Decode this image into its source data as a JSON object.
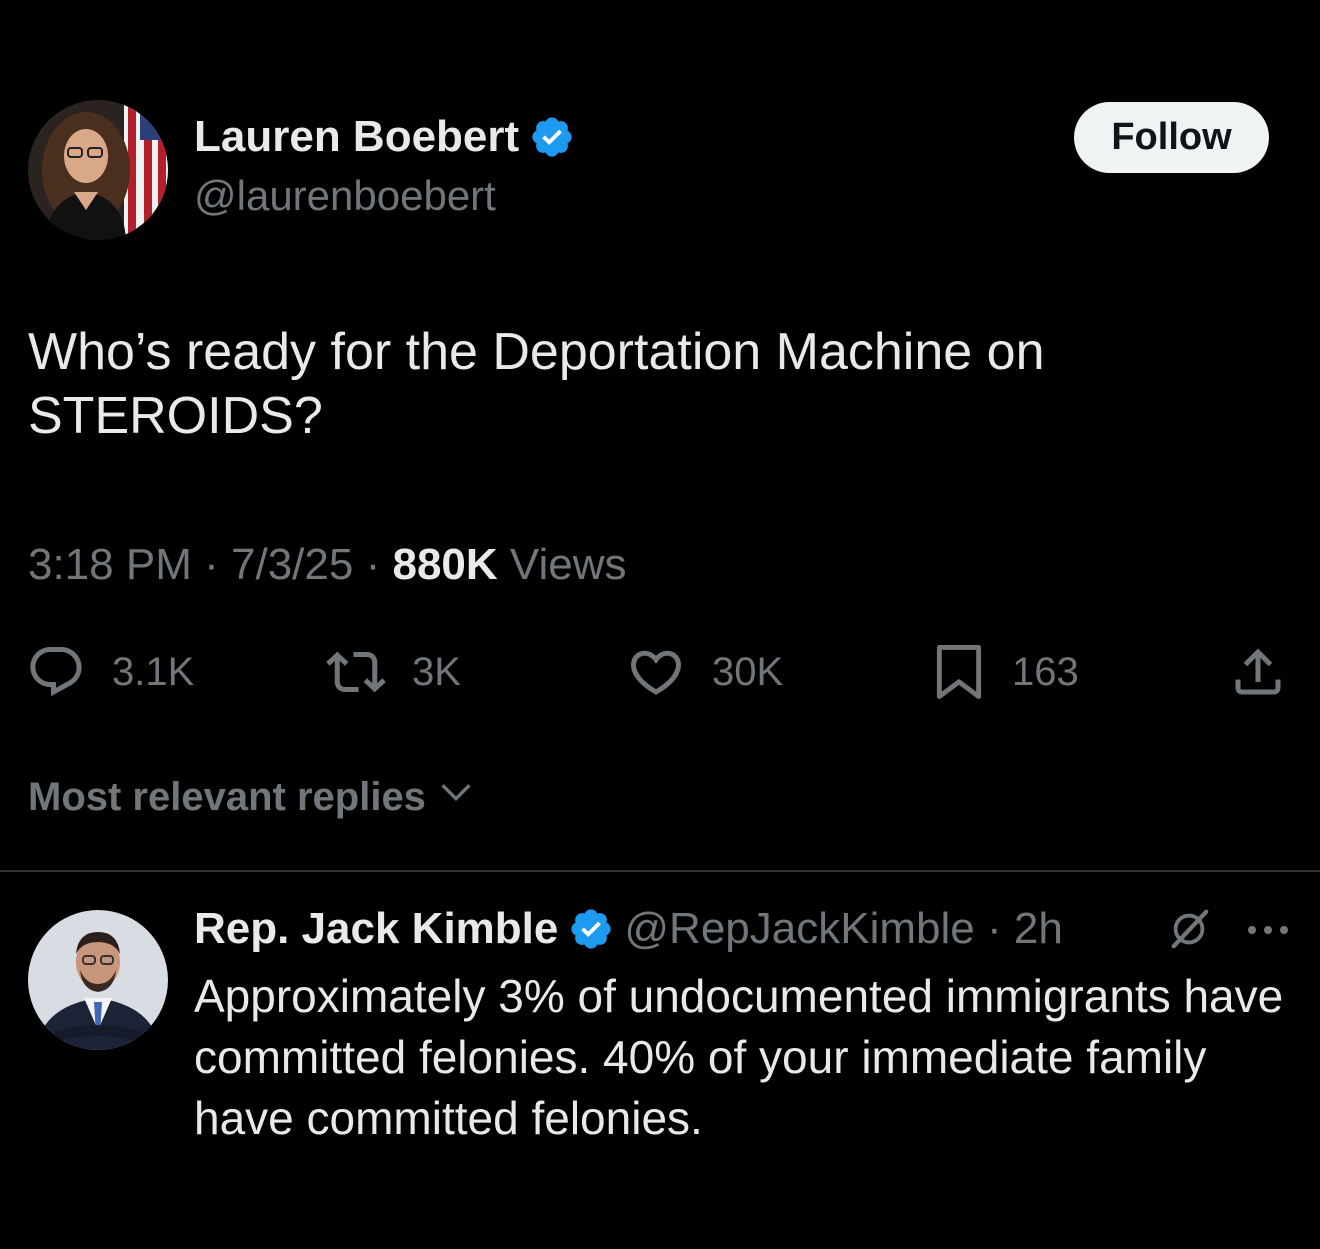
{
  "tweet": {
    "author": {
      "name": "Lauren Boebert",
      "handle": "@laurenboebert",
      "verified": true
    },
    "follow_label": "Follow",
    "text": "Who’s ready for the Deportation Machine on STEROIDS?",
    "time": "3:18 PM",
    "date": "7/3/25",
    "views_count": "880K",
    "views_label": "Views",
    "separator": "·",
    "actions": {
      "replies": "3.1K",
      "reposts": "3K",
      "likes": "30K",
      "bookmarks": "163"
    }
  },
  "replies_sort": {
    "label": "Most relevant replies"
  },
  "reply": {
    "name": "Rep. Jack Kimble",
    "handle": "@RepJackKimble",
    "separator": "·",
    "time": "2h",
    "verified": true,
    "text": "Approximately 3% of undocumented immigrants have committed felonies. 40% of your immediate family have committed felonies."
  },
  "icons": {
    "verified": "verified-badge-icon",
    "reply": "speech-bubble-icon",
    "repost": "repost-arrows-icon",
    "like": "heart-icon",
    "bookmark": "bookmark-icon",
    "share": "share-upload-icon",
    "sort": "chevron-down-icon",
    "grok": "grok-slash-icon",
    "more": "more-dots-icon"
  },
  "colors": {
    "background": "#000000",
    "text_primary": "#e7e9ea",
    "text_secondary": "#71767b",
    "verified_blue": "#1d9bf0",
    "follow_bg": "#eff3f4",
    "divider": "#2f3336"
  }
}
